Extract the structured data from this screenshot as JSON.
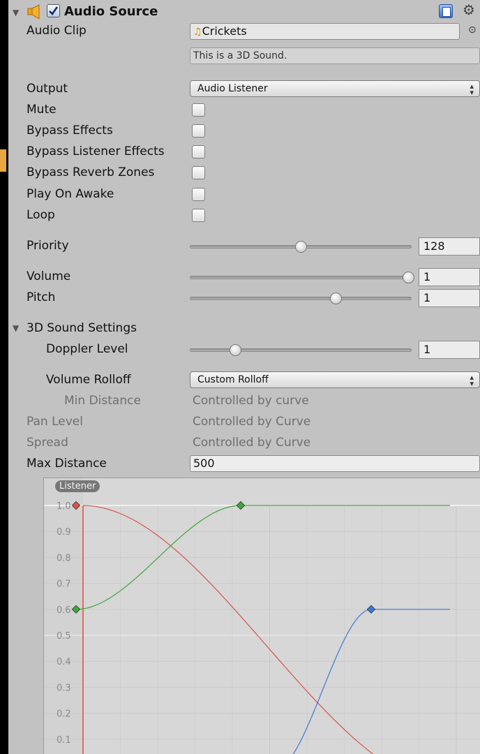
{
  "component": {
    "title": "Audio Source",
    "enabled": true
  },
  "audio_clip": {
    "label": "Audio Clip",
    "value": "Crickets",
    "info": "This is a 3D Sound."
  },
  "output": {
    "label": "Output",
    "value": "Audio Listener"
  },
  "toggles": [
    {
      "label": "Mute",
      "checked": false
    },
    {
      "label": "Bypass Effects",
      "checked": false
    },
    {
      "label": "Bypass Listener Effects",
      "checked": false
    },
    {
      "label": "Bypass Reverb Zones",
      "checked": false
    },
    {
      "label": "Play On Awake",
      "checked": false
    },
    {
      "label": "Loop",
      "checked": false
    }
  ],
  "sliders": {
    "priority": {
      "label": "Priority",
      "value": "128",
      "fraction": 0.5
    },
    "volume": {
      "label": "Volume",
      "value": "1",
      "fraction": 1.0
    },
    "pitch": {
      "label": "Pitch",
      "value": "1",
      "fraction": 0.66
    }
  },
  "sound3d": {
    "header": "3D Sound Settings",
    "doppler": {
      "label": "Doppler Level",
      "value": "1",
      "fraction": 0.2
    },
    "volume_rolloff": {
      "label": "Volume Rolloff",
      "value": "Custom Rolloff"
    },
    "min_distance": {
      "label": "Min Distance",
      "value": "Controlled by curve"
    },
    "pan_level": {
      "label": "Pan Level",
      "value": "Controlled by Curve"
    },
    "spread": {
      "label": "Spread",
      "value": "Controlled by Curve"
    },
    "max_distance": {
      "label": "Max Distance",
      "value": "500"
    }
  },
  "chart_data": {
    "type": "line",
    "badge": "Listener",
    "ytick_labels": [
      "1.0",
      "0.9",
      "0.8",
      "0.7",
      "0.6",
      "0.5",
      "0.4",
      "0.3",
      "0.2",
      "0.1"
    ],
    "ylim": [
      0,
      1.0
    ],
    "grid": true,
    "colors": {
      "red": "#d9534a",
      "green": "#3fa53a",
      "blue": "#3c78d8"
    }
  }
}
